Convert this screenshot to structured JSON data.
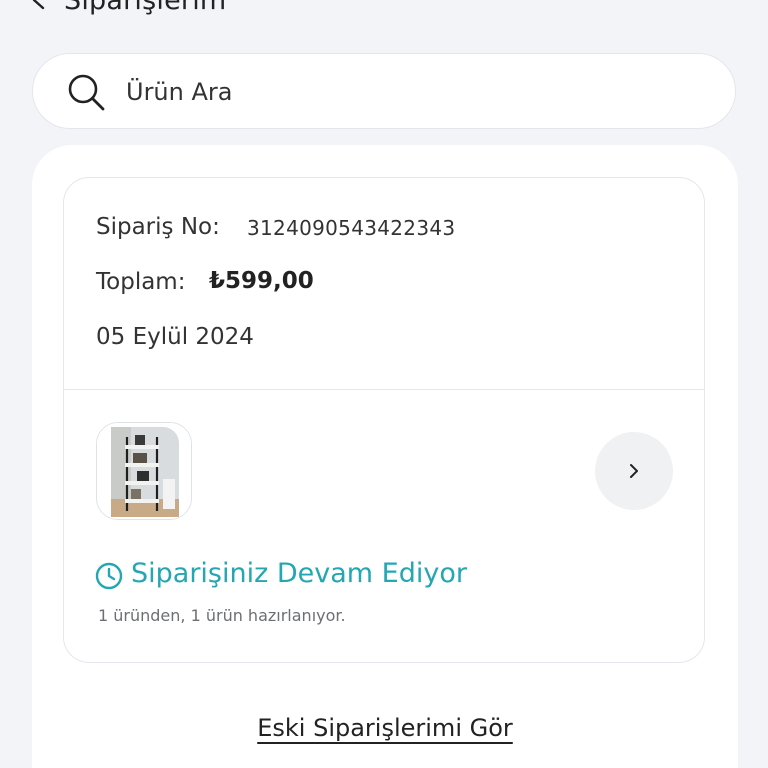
{
  "header": {
    "title": "Siparişlerim",
    "back_icon": "chevron-left-icon"
  },
  "search": {
    "placeholder": "Ürün Ara",
    "icon": "search-icon"
  },
  "order": {
    "order_no_label": "Sipariş No:",
    "order_no_value": "3124090543422343",
    "total_label": "Toplam:",
    "total_value": "₺599,00",
    "date": "05 Eylül 2024",
    "status_text": "Siparişiniz Devam Ediyor",
    "status_subtext": "1 üründen, 1 ürün hazırlanıyor.",
    "status_color": "#23a7b3",
    "thumbnail_icon": "product-thumbnail"
  },
  "footer": {
    "old_orders_link": "Eski Siparişlerimi Gör"
  }
}
